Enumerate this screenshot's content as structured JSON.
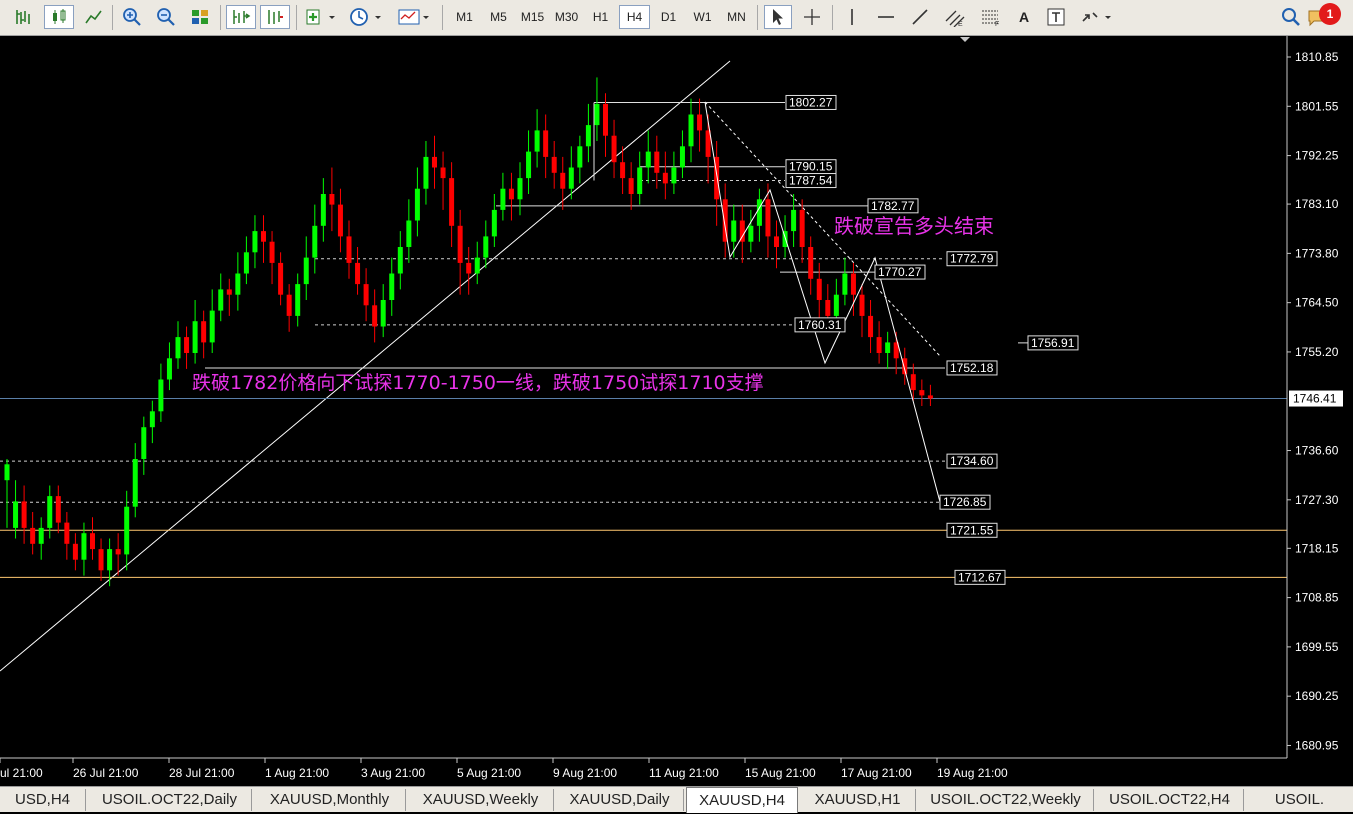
{
  "toolbar": {
    "timeframes": [
      "M1",
      "M5",
      "M15",
      "M30",
      "H1",
      "H4",
      "D1",
      "W1",
      "MN"
    ],
    "active_timeframe": "H4",
    "alert_count": "1",
    "text_tool_label": "A"
  },
  "colors": {
    "background": "#000000",
    "bull": "#00ff00",
    "bear": "#ff0000",
    "orange_line": "#ffc870",
    "annotation": "#e833e8",
    "trendline": "#ffffff",
    "current_price_line": "#5a7fa8"
  },
  "chart_data": {
    "type": "candlestick",
    "symbol": "XAUUSD,H4",
    "price_axis": {
      "ticks": [
        1810.85,
        1801.55,
        1792.25,
        1783.1,
        1773.8,
        1764.5,
        1755.2,
        1746.41,
        1736.6,
        1727.3,
        1718.15,
        1708.85,
        1699.55,
        1690.25,
        1680.95
      ],
      "current_price": 1746.41
    },
    "time_axis": {
      "labels": [
        "ul 21:00",
        "26 Jul 21:00",
        "28 Jul 21:00",
        "1 Aug 21:00",
        "3 Aug 21:00",
        "5 Aug 21:00",
        "9 Aug 21:00",
        "11 Aug 21:00",
        "15 Aug 21:00",
        "17 Aug 21:00",
        "19 Aug 21:00"
      ]
    },
    "candles": [
      [
        1731,
        1734,
        1722,
        1735
      ],
      [
        1722,
        1727,
        1720,
        1731
      ],
      [
        1727,
        1722,
        1719,
        1730
      ],
      [
        1722,
        1719,
        1717,
        1725
      ],
      [
        1719,
        1722,
        1716,
        1724
      ],
      [
        1722,
        1728,
        1720,
        1730
      ],
      [
        1728,
        1723,
        1721,
        1730
      ],
      [
        1723,
        1719,
        1716,
        1725
      ],
      [
        1719,
        1716,
        1714,
        1721
      ],
      [
        1716,
        1721,
        1713,
        1723
      ],
      [
        1721,
        1718,
        1716,
        1724
      ],
      [
        1718,
        1714,
        1712,
        1720
      ],
      [
        1714,
        1718,
        1711,
        1720
      ],
      [
        1718,
        1717,
        1713,
        1721
      ],
      [
        1717,
        1726,
        1714,
        1729
      ],
      [
        1726,
        1735,
        1724,
        1738
      ],
      [
        1735,
        1741,
        1732,
        1743
      ],
      [
        1741,
        1744,
        1738,
        1746
      ],
      [
        1744,
        1750,
        1742,
        1753
      ],
      [
        1750,
        1754,
        1748,
        1757
      ],
      [
        1754,
        1758,
        1752,
        1761
      ],
      [
        1758,
        1755,
        1752,
        1760
      ],
      [
        1755,
        1761,
        1753,
        1765
      ],
      [
        1761,
        1757,
        1754,
        1763
      ],
      [
        1757,
        1763,
        1755,
        1767
      ],
      [
        1763,
        1767,
        1761,
        1770
      ],
      [
        1767,
        1766,
        1762,
        1769
      ],
      [
        1766,
        1770,
        1763,
        1774
      ],
      [
        1770,
        1774,
        1768,
        1777
      ],
      [
        1774,
        1778,
        1771,
        1781
      ],
      [
        1778,
        1776,
        1772,
        1781
      ],
      [
        1776,
        1772,
        1768,
        1778
      ],
      [
        1772,
        1766,
        1764,
        1774
      ],
      [
        1766,
        1762,
        1759,
        1768
      ],
      [
        1762,
        1768,
        1760,
        1770
      ],
      [
        1768,
        1773,
        1765,
        1777
      ],
      [
        1773,
        1779,
        1770,
        1783
      ],
      [
        1779,
        1785,
        1776,
        1788
      ],
      [
        1785,
        1783,
        1778,
        1790
      ],
      [
        1783,
        1777,
        1774,
        1786
      ],
      [
        1777,
        1772,
        1769,
        1780
      ],
      [
        1772,
        1768,
        1766,
        1775
      ],
      [
        1768,
        1764,
        1761,
        1771
      ],
      [
        1764,
        1760,
        1757,
        1767
      ],
      [
        1760,
        1765,
        1758,
        1768
      ],
      [
        1765,
        1770,
        1762,
        1773
      ],
      [
        1770,
        1775,
        1767,
        1778
      ],
      [
        1775,
        1780,
        1772,
        1784
      ],
      [
        1780,
        1786,
        1777,
        1790
      ],
      [
        1786,
        1792,
        1783,
        1795
      ],
      [
        1792,
        1790,
        1786,
        1796
      ],
      [
        1790,
        1788,
        1782,
        1793
      ],
      [
        1788,
        1779,
        1775,
        1791
      ],
      [
        1779,
        1772,
        1766,
        1782
      ],
      [
        1772,
        1770,
        1766,
        1775
      ],
      [
        1770,
        1773,
        1768,
        1776
      ],
      [
        1773,
        1777,
        1771,
        1780
      ],
      [
        1777,
        1782,
        1775,
        1785
      ],
      [
        1782,
        1786,
        1780,
        1789
      ],
      [
        1786,
        1784,
        1780,
        1789
      ],
      [
        1784,
        1788,
        1781,
        1791
      ],
      [
        1788,
        1793,
        1785,
        1797
      ],
      [
        1793,
        1797,
        1790,
        1801
      ],
      [
        1797,
        1792,
        1788,
        1800
      ],
      [
        1792,
        1789,
        1786,
        1795
      ],
      [
        1789,
        1786,
        1782,
        1792
      ],
      [
        1786,
        1790,
        1784,
        1794
      ],
      [
        1790,
        1794,
        1787,
        1796
      ],
      [
        1794,
        1798,
        1791,
        1802
      ],
      [
        1798,
        1802,
        1795,
        1807
      ],
      [
        1802,
        1796,
        1792,
        1804
      ],
      [
        1796,
        1791,
        1788,
        1799
      ],
      [
        1791,
        1788,
        1785,
        1794
      ],
      [
        1788,
        1785,
        1782,
        1791
      ],
      [
        1785,
        1790,
        1783,
        1793
      ],
      [
        1790,
        1793,
        1787,
        1797
      ],
      [
        1793,
        1789,
        1786,
        1796
      ],
      [
        1789,
        1787,
        1784,
        1793
      ],
      [
        1787,
        1790,
        1785,
        1793
      ],
      [
        1790,
        1794,
        1788,
        1797
      ],
      [
        1794,
        1800,
        1791,
        1803
      ],
      [
        1800,
        1797,
        1793,
        1803
      ],
      [
        1797,
        1792,
        1787,
        1800
      ],
      [
        1792,
        1784,
        1779,
        1795
      ],
      [
        1784,
        1776,
        1773,
        1787
      ],
      [
        1776,
        1780,
        1773,
        1783
      ],
      [
        1780,
        1776,
        1772,
        1783
      ],
      [
        1776,
        1779,
        1774,
        1782
      ],
      [
        1779,
        1784,
        1776,
        1786
      ],
      [
        1784,
        1777,
        1773,
        1787
      ],
      [
        1777,
        1775,
        1771,
        1780
      ],
      [
        1775,
        1778,
        1773,
        1781
      ],
      [
        1778,
        1782,
        1775,
        1785
      ],
      [
        1782,
        1775,
        1772,
        1784
      ],
      [
        1775,
        1769,
        1766,
        1777
      ],
      [
        1769,
        1765,
        1761,
        1772
      ],
      [
        1765,
        1762,
        1760,
        1768
      ],
      [
        1762,
        1766,
        1760,
        1769
      ],
      [
        1766,
        1770,
        1764,
        1773
      ],
      [
        1770,
        1766,
        1762,
        1772
      ],
      [
        1766,
        1762,
        1758,
        1768
      ],
      [
        1762,
        1758,
        1755,
        1765
      ],
      [
        1758,
        1755,
        1753,
        1761
      ],
      [
        1755,
        1757,
        1752,
        1759
      ],
      [
        1757,
        1754,
        1751,
        1759
      ],
      [
        1754,
        1751,
        1749,
        1756
      ],
      [
        1751,
        1748,
        1746,
        1753
      ],
      [
        1748,
        1747,
        1745,
        1750
      ],
      [
        1747,
        1746.41,
        1745,
        1749
      ]
    ],
    "horizontal_levels": [
      {
        "price": 1802.27,
        "label": "1802.27",
        "style": "solid"
      },
      {
        "price": 1790.15,
        "label": "1790.15",
        "style": "solid"
      },
      {
        "price": 1787.54,
        "label": "1787.54",
        "style": "dotted"
      },
      {
        "price": 1782.77,
        "label": "1782.77",
        "style": "solid"
      },
      {
        "price": 1772.79,
        "label": "1772.79",
        "style": "dotted"
      },
      {
        "price": 1770.27,
        "label": "1770.27",
        "style": "solid"
      },
      {
        "price": 1760.31,
        "label": "1760.31",
        "style": "dotted"
      },
      {
        "price": 1756.91,
        "label": "1756.91",
        "style": "solid"
      },
      {
        "price": 1752.18,
        "label": "1752.18",
        "style": "solid"
      },
      {
        "price": 1734.6,
        "label": "1734.60",
        "style": "dotted"
      },
      {
        "price": 1726.85,
        "label": "1726.85",
        "style": "dotted"
      },
      {
        "price": 1721.55,
        "label": "1721.55",
        "style": "orange"
      },
      {
        "price": 1712.67,
        "label": "1712.67",
        "style": "orange"
      }
    ],
    "annotations": [
      {
        "text": "跌破宣告多头结束"
      },
      {
        "text": "跌破1782价格向下试探1770-1750一线，跌破1750试探1710支撑"
      }
    ]
  },
  "tabs": [
    {
      "label": "USD,H4",
      "active": false
    },
    {
      "label": "USOIL.OCT22,Daily",
      "active": false
    },
    {
      "label": "XAUUSD,Monthly",
      "active": false
    },
    {
      "label": "XAUUSD,Weekly",
      "active": false
    },
    {
      "label": "XAUUSD,Daily",
      "active": false
    },
    {
      "label": "XAUUSD,H4",
      "active": true
    },
    {
      "label": "XAUUSD,H1",
      "active": false
    },
    {
      "label": "USOIL.OCT22,Weekly",
      "active": false
    },
    {
      "label": "USOIL.OCT22,H4",
      "active": false
    },
    {
      "label": "USOIL.",
      "active": false
    }
  ]
}
